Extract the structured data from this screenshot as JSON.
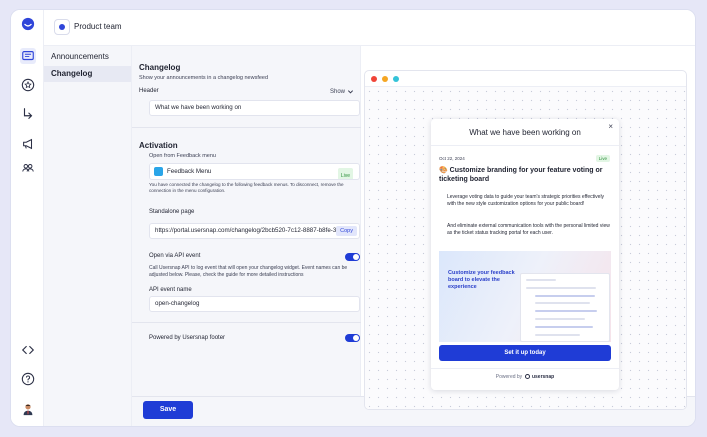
{
  "team": {
    "name": "Product team"
  },
  "rail": {
    "icons": [
      "logo-icon",
      "feedback-icon",
      "star-icon",
      "flow-icon",
      "megaphone-icon",
      "users-icon",
      "code-icon",
      "help-icon",
      "avatar-icon"
    ]
  },
  "subnav": {
    "items": [
      {
        "label": "Announcements"
      },
      {
        "label": "Changelog"
      }
    ]
  },
  "changelog": {
    "title": "Changelog",
    "subtitle": "Show your announcements in a changelog newsfeed",
    "header_label": "Header",
    "show_label": "Show",
    "header_value": "What we have been working on"
  },
  "activation": {
    "title": "Activation",
    "open_from": "Open from Feedback menu",
    "menu_name": "Feedback Menu",
    "menu_status": "Live",
    "menu_note": "You have connected the changelog to the following feedback menus. To disconnect, remove the connection in the menu configuration.",
    "standalone_label": "Standalone page",
    "standalone_url": "https://portal.usersnap.com/changelog/2bcb520-7c12-8887-b8fe-3",
    "copy_label": "Copy",
    "api_label": "Open via API event",
    "api_note": "Call Usersnap API to log event that will open your changelog widget. Event names can be adjusted below. Please, check the guide for more detailed instructions",
    "api_event_label": "API event name",
    "api_event_value": "open-changelog",
    "api_enabled": true,
    "powered_label": "Powered by Usersnap footer",
    "powered_enabled": true
  },
  "footer": {
    "save_label": "Save"
  },
  "preview": {
    "dot_colors": [
      "#f04438",
      "#f5a623",
      "#34c3d8"
    ],
    "card_title": "What we have been working on",
    "close_glyph": "×",
    "date": "Oct 22, 2024",
    "status": "Live",
    "post_title": "🎨 Customize branding for your feature voting or ticketing board",
    "para1": "Leverage voting data to guide your team's strategic priorities effectively with the new style customization options for your public board!",
    "para2": "And eliminate external communication tools with the personal limited view as the ticket status tracking portal for each user.",
    "promo_text": "Customize your feedback board to elevate the experience",
    "cta_label": "Set it up today",
    "powered_by": "Powered by",
    "brand": "usersnap"
  },
  "colors": {
    "accent": "#1f3cd6",
    "live_bg": "#e2f6e4",
    "live_fg": "#2d8f3c"
  }
}
